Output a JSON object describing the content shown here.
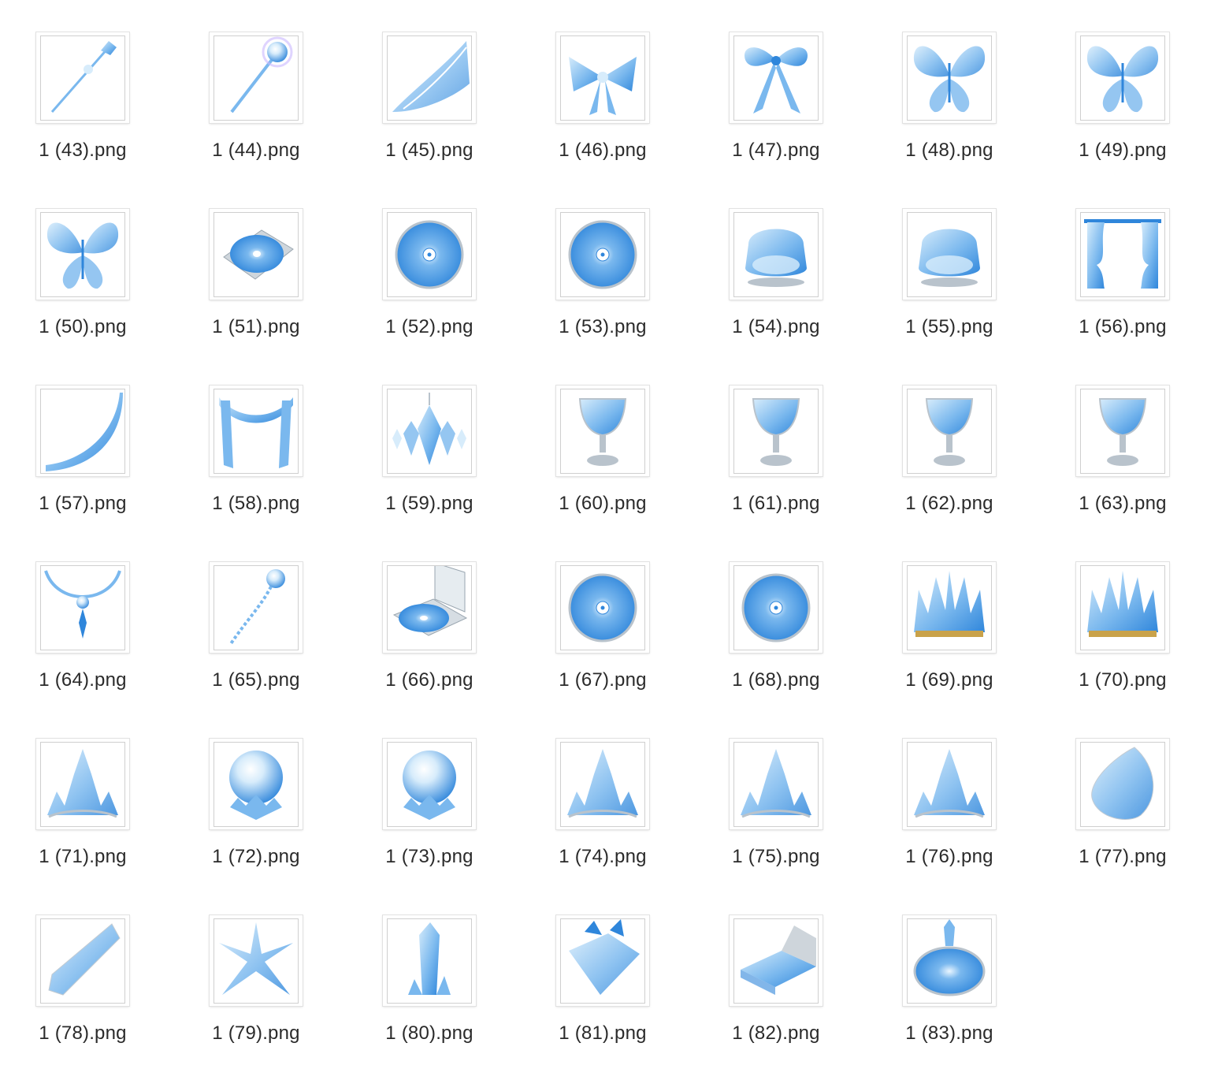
{
  "window": {
    "view": "icon-grid"
  },
  "colors": {
    "ice_light": "#d7ecfb",
    "ice_mid": "#7ab8ee",
    "ice_deep": "#2f86db",
    "silver": "#b9c3cc",
    "gold": "#c9a24a"
  },
  "files": [
    {
      "name": "1 (43).png",
      "icon": "crystal-wand-icon"
    },
    {
      "name": "1 (44).png",
      "icon": "orb-scepter-icon"
    },
    {
      "name": "1 (45).png",
      "icon": "crystal-wing-icon"
    },
    {
      "name": "1 (46).png",
      "icon": "crystal-bow-icon"
    },
    {
      "name": "1 (47).png",
      "icon": "ribbon-bow-icon"
    },
    {
      "name": "1 (48).png",
      "icon": "butterfly-icon"
    },
    {
      "name": "1 (49).png",
      "icon": "butterfly-icon"
    },
    {
      "name": "1 (50).png",
      "icon": "butterfly-icon"
    },
    {
      "name": "1 (51).png",
      "icon": "disc-case-icon"
    },
    {
      "name": "1 (52).png",
      "icon": "disc-icon"
    },
    {
      "name": "1 (53).png",
      "icon": "disc-icon"
    },
    {
      "name": "1 (54).png",
      "icon": "crystal-armchair-icon"
    },
    {
      "name": "1 (55).png",
      "icon": "crystal-armchair-icon"
    },
    {
      "name": "1 (56).png",
      "icon": "curtains-icon"
    },
    {
      "name": "1 (57).png",
      "icon": "drape-icon"
    },
    {
      "name": "1 (58).png",
      "icon": "valance-drape-icon"
    },
    {
      "name": "1 (59).png",
      "icon": "chandelier-icon"
    },
    {
      "name": "1 (60).png",
      "icon": "goblet-icon"
    },
    {
      "name": "1 (61).png",
      "icon": "goblet-icon"
    },
    {
      "name": "1 (62).png",
      "icon": "goblet-icon"
    },
    {
      "name": "1 (63).png",
      "icon": "goblet-icon"
    },
    {
      "name": "1 (64).png",
      "icon": "necklace-icon"
    },
    {
      "name": "1 (65).png",
      "icon": "pendant-chain-icon"
    },
    {
      "name": "1 (66).png",
      "icon": "turntable-icon"
    },
    {
      "name": "1 (67).png",
      "icon": "disc-icon"
    },
    {
      "name": "1 (68).png",
      "icon": "disc-icon"
    },
    {
      "name": "1 (69).png",
      "icon": "crown-icon"
    },
    {
      "name": "1 (70).png",
      "icon": "crown-icon"
    },
    {
      "name": "1 (71).png",
      "icon": "tiara-icon"
    },
    {
      "name": "1 (72).png",
      "icon": "crystal-ball-icon"
    },
    {
      "name": "1 (73).png",
      "icon": "crystal-ball-icon"
    },
    {
      "name": "1 (74).png",
      "icon": "tiara-icon"
    },
    {
      "name": "1 (75).png",
      "icon": "tiara-icon"
    },
    {
      "name": "1 (76).png",
      "icon": "tiara-icon"
    },
    {
      "name": "1 (77).png",
      "icon": "gem-drop-icon"
    },
    {
      "name": "1 (78).png",
      "icon": "crystal-shard-icon"
    },
    {
      "name": "1 (79).png",
      "icon": "star-crystal-icon"
    },
    {
      "name": "1 (80).png",
      "icon": "crystal-pillar-icon"
    },
    {
      "name": "1 (81).png",
      "icon": "crystal-pillow-icon"
    },
    {
      "name": "1 (82).png",
      "icon": "crystal-bed-icon"
    },
    {
      "name": "1 (83).png",
      "icon": "crystal-fountain-icon"
    }
  ]
}
